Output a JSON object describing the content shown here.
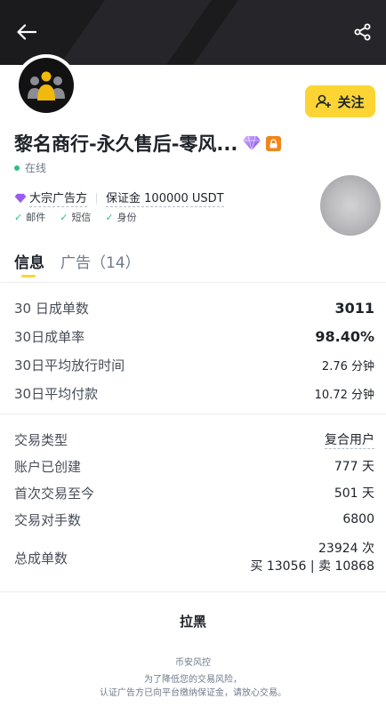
{
  "header": {
    "back_icon": "arrow-left-icon",
    "share_icon": "share-icon"
  },
  "profile": {
    "avatar_icon": "group-users-icon",
    "follow_label": "关注",
    "name": "黎名商行-永久售后-零风...",
    "status": "在线",
    "tag_large": "大宗广告方",
    "deposit": "保证金 100000 USDT",
    "verifications": [
      "邮件",
      "短信",
      "身份"
    ]
  },
  "tabs": [
    "信息",
    "广告（14）"
  ],
  "stats": [
    {
      "label": "30 日成单数",
      "value": "3011"
    },
    {
      "label": "30日成单率",
      "value": "98.40%"
    },
    {
      "label": "30日平均放行时间",
      "value": "2.76 分钟"
    },
    {
      "label": "30日平均付款",
      "value": "10.72 分钟"
    }
  ],
  "info": [
    {
      "label": "交易类型",
      "value": "复合用户"
    },
    {
      "label": "账户已创建",
      "value": "777 天"
    },
    {
      "label": "首次交易至今",
      "value": "501 天"
    },
    {
      "label": "交易对手数",
      "value": "6800"
    }
  ],
  "total": {
    "label": "总成单数",
    "count": "23924 次",
    "breakdown": "买 13056 | 卖 10868"
  },
  "blacklist_label": "拉黑",
  "footer": {
    "title": "币安风控",
    "line1": "为了降低您的交易风险，",
    "line2": "认证广告方已向平台缴纳保证金，请放心交易。"
  },
  "colors": {
    "brand_yellow": "#fcd535",
    "online_green": "#2ebd85",
    "header_dark": "#1b1b1d"
  }
}
